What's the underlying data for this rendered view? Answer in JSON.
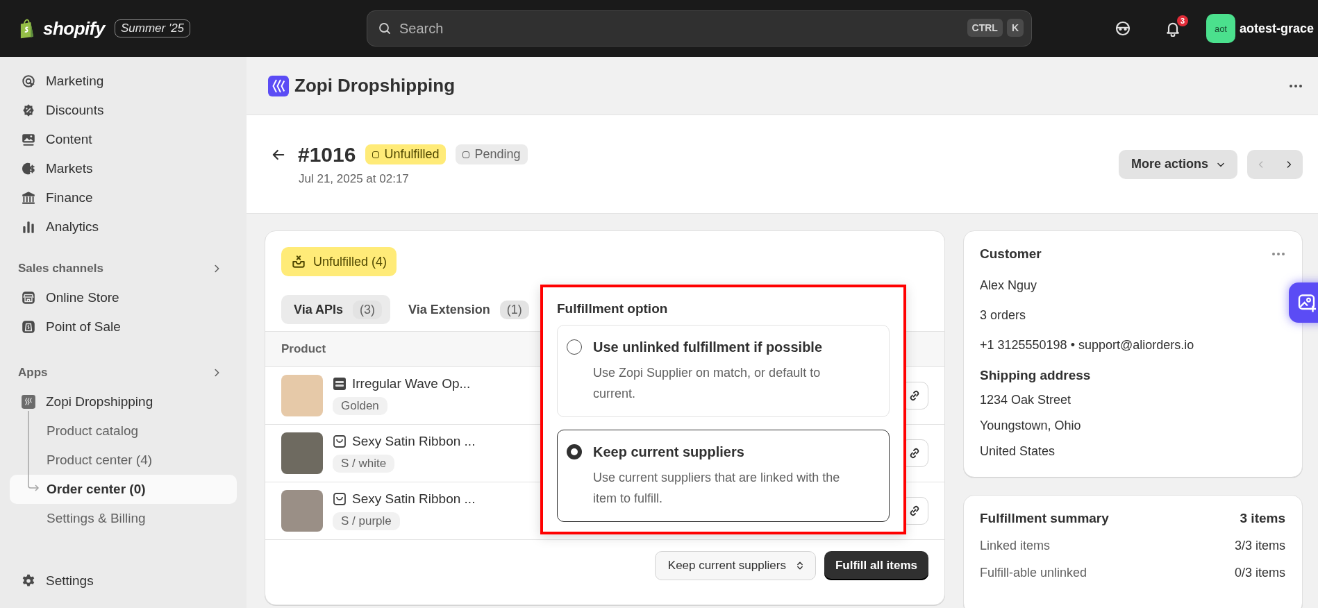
{
  "topbar": {
    "brand": "shopify",
    "edition": "Summer '25",
    "search": {
      "placeholder": "Search",
      "shortcut": [
        "CTRL",
        "K"
      ]
    },
    "notifications": "3",
    "avatar": "aot",
    "user": "aotest-grace"
  },
  "sidebar": {
    "main_items": [
      {
        "label": "Marketing",
        "selected": false
      },
      {
        "label": "Discounts",
        "selected": false
      },
      {
        "label": "Content",
        "selected": false
      },
      {
        "label": "Markets",
        "selected": false
      },
      {
        "label": "Finance",
        "selected": false
      },
      {
        "label": "Analytics",
        "selected": false
      }
    ],
    "sales_channels": {
      "title": "Sales channels",
      "items": [
        {
          "label": "Online Store",
          "selected": false
        },
        {
          "label": "Point of Sale",
          "selected": false
        }
      ]
    },
    "apps": {
      "title": "Apps",
      "items": [
        {
          "label": "Zopi Dropshipping",
          "children": [
            {
              "label": "Product catalog",
              "selected": false
            },
            {
              "label": "Product center (4)",
              "selected": false
            },
            {
              "label": "Order center (0)",
              "selected": true
            },
            {
              "label": "Settings & Billing",
              "selected": false
            }
          ]
        }
      ]
    },
    "settings": {
      "label": "Settings",
      "selected": false
    }
  },
  "app_header": {
    "title": "Zopi Dropshipping"
  },
  "order": {
    "number": "#1016",
    "date": "Jul 21, 2025 at 02:17",
    "badges": [
      {
        "label": "Unfulfilled",
        "kind": "attention"
      },
      {
        "label": "Pending",
        "kind": "neutral"
      }
    ],
    "more_actions": "More actions",
    "previous_disabled": true,
    "next_disabled": false
  },
  "fulfillment_card": {
    "status": "Unfulfilled (4)",
    "tabs": [
      {
        "label": "Via APIs",
        "count": "(3)",
        "selected": true
      },
      {
        "label": "Via Extension",
        "count": "(1)",
        "selected": false
      }
    ],
    "table": {
      "columns": [
        "Product"
      ],
      "rows": [
        {
          "name": "Irregular Wave Op...",
          "variant": "Golden",
          "kind": "marketplace"
        },
        {
          "name": "Sexy Satin Ribbon ...",
          "variant": "S / white",
          "kind": "store"
        },
        {
          "name": "Sexy Satin Ribbon ...",
          "variant": "S / purple",
          "kind": "store"
        }
      ]
    },
    "supplier_select": "Keep current suppliers",
    "fulfill_button": "Fulfill all items",
    "popover": {
      "title": "Fulfillment option",
      "options": [
        {
          "title": "Use unlinked fulfillment if possible",
          "description": "Use Zopi Supplier on match, or default to current.",
          "selected": false
        },
        {
          "title": "Keep current suppliers",
          "description": "Use current suppliers that are linked with the item to fulfill.",
          "selected": true
        }
      ]
    }
  },
  "customer": {
    "title": "Customer",
    "name": "Alex Nguy",
    "orders": "3 orders",
    "contact": "+1 3125550198 • support@aliorders.io",
    "shipping_title": "Shipping address",
    "address": [
      "1234 Oak Street",
      "Youngstown, Ohio",
      "United States"
    ]
  },
  "summary": {
    "title": "Fulfillment summary",
    "total": "3 items",
    "rows": [
      {
        "label": "Linked items",
        "value": "3/3 items"
      },
      {
        "label": "Fulfill-able unlinked",
        "value": "0/3 items"
      }
    ]
  }
}
